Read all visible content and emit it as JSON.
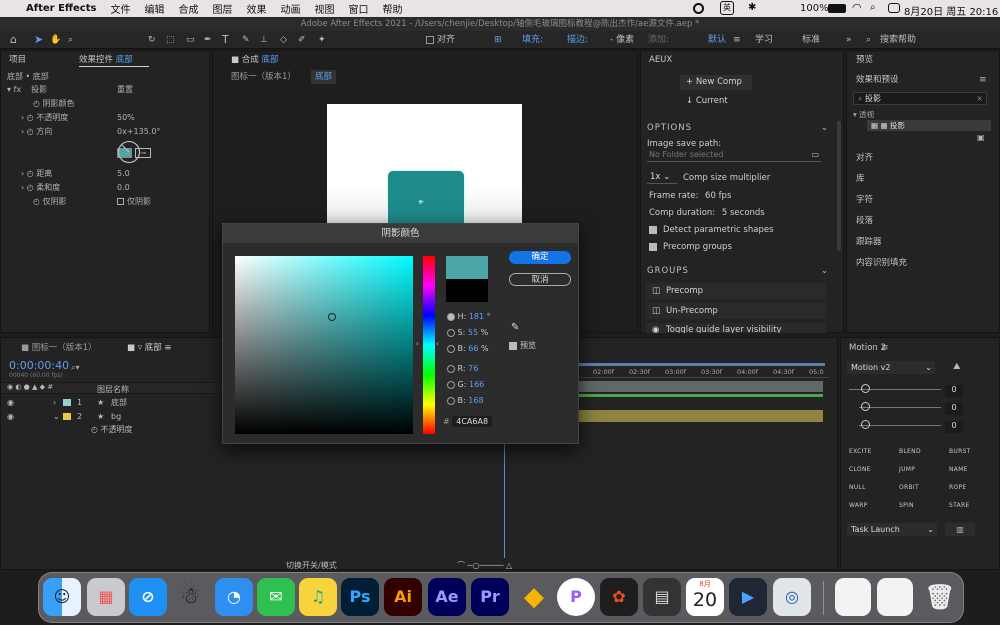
{
  "menubar": {
    "app_name": "After Effects",
    "menus": [
      "文件",
      "编辑",
      "合成",
      "图层",
      "效果",
      "动画",
      "视图",
      "窗口",
      "帮助"
    ],
    "input_method": "英",
    "battery": "100%",
    "datetime": "8月20日 周五  20:16"
  },
  "window_title": "Adobe After Effects 2021 - /Users/chenjie/Desktop/轴侧毛玻璃图标教程@陈出杰作/ae源文件.aep *",
  "toolbar": {
    "align_label": "对齐",
    "fill_label": "填充:",
    "stroke_label": "描边:",
    "stroke_value": "- 像素",
    "add_label": "添加:",
    "workspaces": [
      "默认",
      "学习",
      "标准"
    ],
    "search_placeholder": "搜索帮助"
  },
  "colors": {
    "accent_blue": "#4a8fe8",
    "teal_swatch": "#4CA6A8"
  },
  "effect_controls": {
    "tab_project": "项目",
    "tab_label": "效果控件",
    "tab_layer": "底部",
    "path": "底部 • 底部",
    "effect_name": "投影",
    "reset": "重置",
    "props": [
      {
        "name": "阴影颜色",
        "value": ""
      },
      {
        "name": "不透明度",
        "value": "50%"
      },
      {
        "name": "方向",
        "value": "0x+135.0°"
      },
      {
        "name": "距离",
        "value": "5.0"
      },
      {
        "name": "柔和度",
        "value": "0.0"
      },
      {
        "name": "仅阴影",
        "value": "仅阴影"
      }
    ]
  },
  "composition": {
    "tab_label": "合成",
    "tab_name": "底部",
    "breadcrumb_1": "图标一（版本1）",
    "breadcrumb_2": "底部"
  },
  "aeux": {
    "title": "AEUX",
    "new_comp": "New Comp",
    "current": "Current",
    "options_header": "OPTIONS",
    "image_save_label": "Image save path:",
    "image_save_value": "No Folder selected",
    "size_multiplier_value": "1x",
    "size_multiplier_label": "Comp size multiplier",
    "frame_rate_label": "Frame rate:",
    "frame_rate_value": "60",
    "frame_rate_unit": "fps",
    "duration_label": "Comp duration:",
    "duration_value": "5",
    "duration_unit": "seconds",
    "detect_shapes": "Detect parametric shapes",
    "precomp_groups": "Precomp groups",
    "groups_header": "GROUPS",
    "group_items": [
      "Precomp",
      "Un-Precomp",
      "Toggle guide layer visibility"
    ]
  },
  "right_panels": {
    "preview": "预览",
    "effects_presets": "效果和预设",
    "search_value": "投影",
    "category": "透视",
    "result": "投影",
    "items": [
      "对齐",
      "库",
      "字符",
      "段落",
      "跟踪器",
      "内容识别填充"
    ]
  },
  "dialog": {
    "title": "阴影颜色",
    "ok": "确定",
    "cancel": "取消",
    "preview_label": "预览",
    "h_label": "H:",
    "h_value": "181",
    "h_unit": "°",
    "s_label": "S:",
    "s_value": "55",
    "s_unit": "%",
    "b_label": "B:",
    "b_value": "66",
    "b_unit": "%",
    "r_label": "R:",
    "r_value": "76",
    "g_label": "G:",
    "g_value": "166",
    "b2_label": "B:",
    "b2_value": "168",
    "hex_label": "#",
    "hex_value": "4CA6A8"
  },
  "timeline": {
    "tab_comp": "图标一（版本1）",
    "tab_layer": "底部",
    "timecode": "0:00:00:40",
    "timecode_sub": "00040 (60.00 fps)",
    "col_layer_name": "图层名称",
    "layers": [
      {
        "num": "1",
        "name": "底部"
      },
      {
        "num": "2",
        "name": "bg"
      }
    ],
    "sub_prop": "不透明度",
    "ruler": [
      "02:00f",
      "02:30f",
      "03:00f",
      "03:30f",
      "04:00f",
      "04:30f",
      "05:0"
    ],
    "toggle_modes": "切换开关/模式"
  },
  "motion": {
    "title": "Motion 2",
    "preset": "Motion v2",
    "values": [
      "0",
      "0",
      "0"
    ],
    "buttons": [
      "EXCITE",
      "BLEND",
      "BURST",
      "CLONE",
      "JUMP",
      "NAME",
      "NULL",
      "ORBIT",
      "ROPE",
      "WARP",
      "SPIN",
      "STARE"
    ],
    "task": "Task Launch"
  },
  "dock": {
    "calendar_month": "8月",
    "calendar_day": "20",
    "apps": [
      "Ps",
      "Ai",
      "Ae",
      "Pr"
    ]
  }
}
